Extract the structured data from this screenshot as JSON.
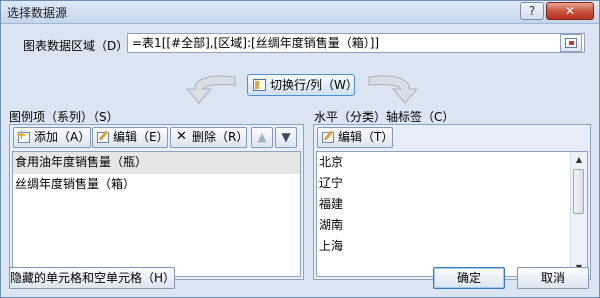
{
  "window": {
    "title": "选择数据源",
    "help_glyph": "?",
    "close_glyph": "✕"
  },
  "data_range": {
    "label": "图表数据区域（D）:",
    "value": "=表1[[#全部],[区域]:[丝绸年度销售量（箱）]]"
  },
  "switch": {
    "label": "切换行/列（W）"
  },
  "legend": {
    "label": "图例项（系列）（S）",
    "add_label": "添加（A）",
    "edit_label": "编辑（E）",
    "delete_label": "删除（R）",
    "delete_glyph": "✕",
    "up_glyph": "▲",
    "down_glyph": "▼",
    "items": [
      {
        "label": "食用油年度销售量（瓶）",
        "selected": true
      },
      {
        "label": "丝绸年度销售量（箱）",
        "selected": false
      }
    ]
  },
  "axis": {
    "label": "水平（分类）轴标签（C）",
    "edit_label": "编辑（T）",
    "items": [
      "北京",
      "辽宁",
      "福建",
      "湖南",
      "上海"
    ],
    "scroll_up_glyph": "▲",
    "scroll_down_glyph": "▼"
  },
  "footer": {
    "hidden_cells_label": "隐藏的单元格和空单元格（H）",
    "ok_label": "确定",
    "cancel_label": "取消"
  }
}
